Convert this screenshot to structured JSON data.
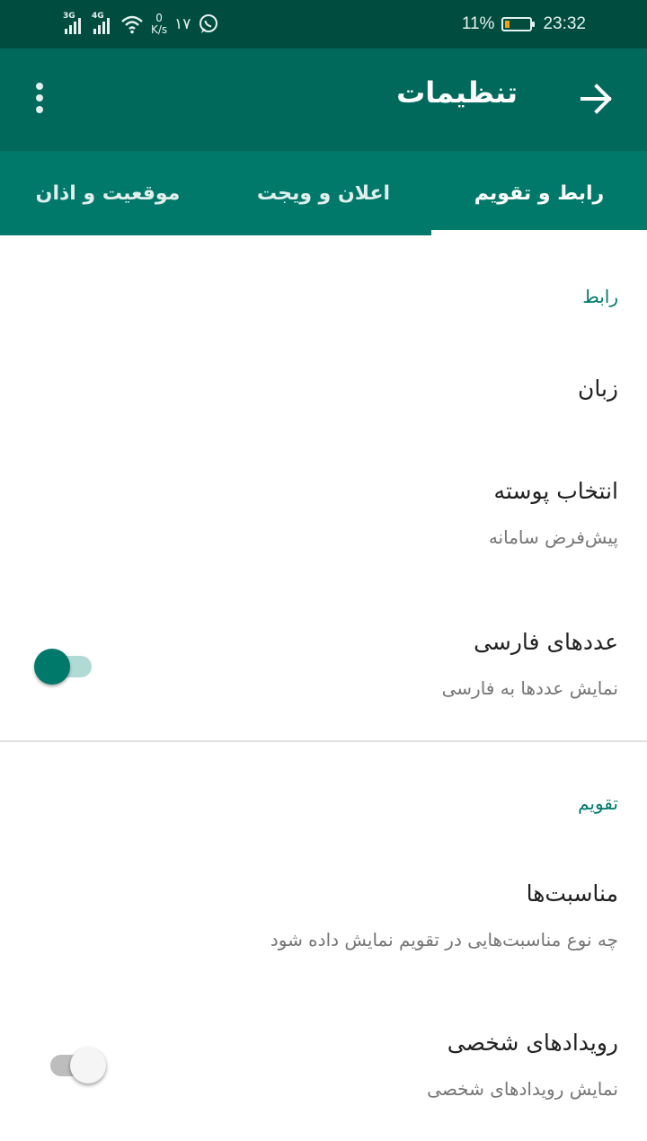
{
  "status_bar": {
    "sim1_type": "3G",
    "sim2_type": "4G",
    "speed_value": "0",
    "speed_unit": "K/s",
    "notif_count": "۱۷",
    "battery_text": "11%",
    "battery_level": 0.11,
    "time": "23:32",
    "icons": [
      "signal-icon",
      "wifi-icon",
      "whatsapp-icon",
      "battery-icon"
    ]
  },
  "app_bar": {
    "title": "تنظیمات",
    "back_icon": "arrow-back-icon",
    "more_icon": "more-vert-icon"
  },
  "tabs": [
    {
      "label": "رابط و تقویم",
      "selected": true
    },
    {
      "label": "اعلان و ویجت",
      "selected": false
    },
    {
      "label": "موقعیت و اذان",
      "selected": false
    }
  ],
  "sections": {
    "interface": {
      "header": "رابط",
      "language": {
        "title": "زبان"
      },
      "theme": {
        "title": "انتخاب پوسته",
        "summary": "پیش‌فرض سامانه"
      },
      "persian_digits": {
        "title": "عددهای فارسی",
        "summary": "نمایش عددها به فارسی",
        "enabled": true
      }
    },
    "calendar": {
      "header": "تقویم",
      "holidays": {
        "title": "مناسبت‌ها",
        "summary": "چه نوع مناسبت‌هایی در تقویم نمایش داده شود"
      },
      "personal_events": {
        "title": "رویدادهای شخصی",
        "summary": "نمایش رویدادهای شخصی",
        "enabled": false
      }
    }
  },
  "colors": {
    "status_bar": "#004d40",
    "app_bar": "#00695c",
    "tabs": "#00796b",
    "accent": "#00796b"
  }
}
